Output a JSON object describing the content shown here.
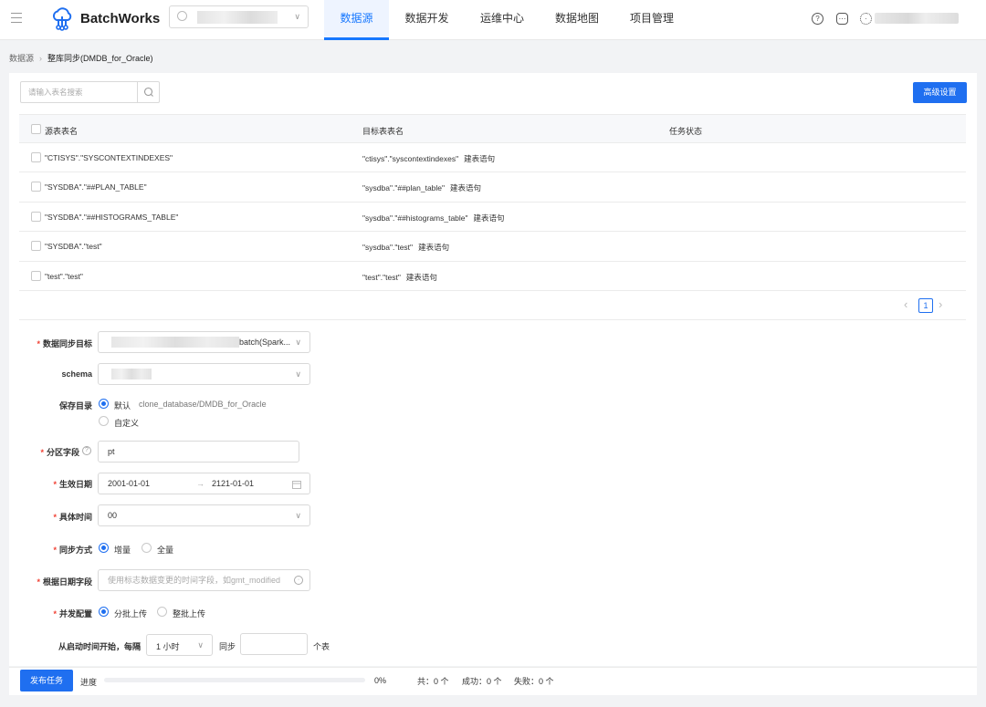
{
  "header": {
    "brand": "BatchWorks",
    "nav": [
      {
        "label": "数据源",
        "active": true
      },
      {
        "label": "数据开发",
        "active": false
      },
      {
        "label": "运维中心",
        "active": false
      },
      {
        "label": "数据地图",
        "active": false
      },
      {
        "label": "项目管理",
        "active": false
      }
    ]
  },
  "breadcrumb": {
    "root": "数据源",
    "current": "整库同步(DMDB_for_Oracle)"
  },
  "search": {
    "placeholder": "请输入表名搜索"
  },
  "advanced_button": "高级设置",
  "table": {
    "columns": [
      "源表表名",
      "目标表表名",
      "任务状态"
    ],
    "rows": [
      {
        "source": "\"CTISYS\".\"SYSCONTEXTINDEXES\"",
        "target": "\"ctisys\".\"syscontextindexes\"",
        "link": "建表语句"
      },
      {
        "source": "\"SYSDBA\".\"##PLAN_TABLE\"",
        "target": "\"sysdba\".\"##plan_table\"",
        "link": "建表语句"
      },
      {
        "source": "\"SYSDBA\".\"##HISTOGRAMS_TABLE\"",
        "target": "\"sysdba\".\"##histograms_table\"",
        "link": "建表语句"
      },
      {
        "source": "\"SYSDBA\".\"test\"",
        "target": "\"sysdba\".\"test\"",
        "link": "建表语句"
      },
      {
        "source": "\"test\".\"test\"",
        "target": "\"test\".\"test\"",
        "link": "建表语句"
      }
    ],
    "page": "1"
  },
  "form": {
    "sync_target": {
      "label": "数据同步目标",
      "value_suffix": "batch(Spark..."
    },
    "schema": {
      "label": "schema"
    },
    "save_dir": {
      "label": "保存目录",
      "opt_default": "默认",
      "default_path": "clone_database/DMDB_for_Oracle",
      "opt_custom": "自定义"
    },
    "partition": {
      "label": "分区字段",
      "value": "pt"
    },
    "effective": {
      "label": "生效日期",
      "start": "2001-01-01",
      "arrow": "→",
      "end": "2121-01-01"
    },
    "time": {
      "label": "具体时间",
      "value": "00"
    },
    "sync_mode": {
      "label": "同步方式",
      "opt1": "增量",
      "opt2": "全量"
    },
    "date_field": {
      "label": "根据日期字段",
      "placeholder": "使用标志数据变更的时间字段，如gmt_modified"
    },
    "concurrency": {
      "label": "并发配置",
      "opt1": "分批上传",
      "opt2": "整批上传"
    },
    "interval": {
      "label": "从启动时间开始，每隔",
      "value": "1 小时",
      "mid": "同步",
      "suffix": "个表"
    }
  },
  "footer": {
    "publish": "发布任务",
    "progress_label": "进度",
    "progress_text": "0%",
    "progress": 0,
    "total": "共：0 个",
    "success": "成功：0 个",
    "fail": "失败：0 个"
  },
  "colors": {
    "primary": "#1f6ff0",
    "required": "#f04134"
  }
}
